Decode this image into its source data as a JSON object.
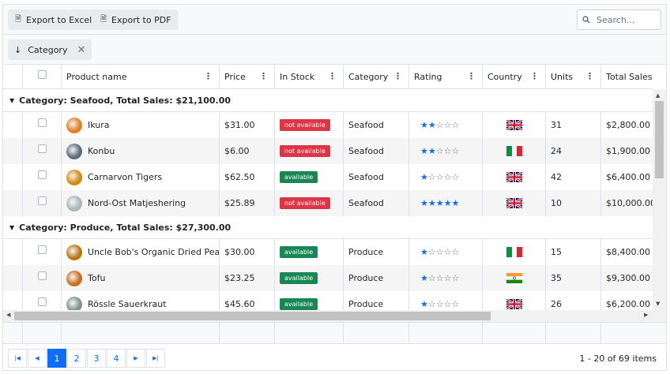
{
  "toolbar": {
    "export_excel_label": "Export to Excel",
    "export_pdf_label": "Export to PDF",
    "search_placeholder": "Search..."
  },
  "group_panel": {
    "chip_label": "Category",
    "chip_sort_glyph": "↓",
    "chip_remove_glyph": "✕"
  },
  "columns": {
    "product": "Product name",
    "price": "Price",
    "in_stock": "In Stock",
    "category": "Category",
    "rating": "Rating",
    "country": "Country",
    "units": "Units",
    "total_sales": "Total Sales"
  },
  "groups": [
    {
      "label": "Category: Seafood, Total Sales: $21,100.00",
      "rows": [
        {
          "name": "Ikura",
          "price": "$31.00",
          "stock": "not available",
          "category": "Seafood",
          "rating": 2,
          "flag": "uk",
          "units": "31",
          "total": "$2,800.00",
          "avatar_color": "#e67e22"
        },
        {
          "name": "Konbu",
          "price": "$6.00",
          "stock": "not available",
          "category": "Seafood",
          "rating": 2,
          "flag": "italy",
          "units": "24",
          "total": "$1,900.00",
          "avatar_color": "#5d6d7e"
        },
        {
          "name": "Carnarvon Tigers",
          "price": "$62.50",
          "stock": "available",
          "category": "Seafood",
          "rating": 1,
          "flag": "uk",
          "units": "42",
          "total": "$6,400.00",
          "avatar_color": "#d68910"
        },
        {
          "name": "Nord-Ost Matjeshering",
          "price": "$25.89",
          "stock": "not available",
          "category": "Seafood",
          "rating": 5,
          "flag": "uk",
          "units": "10",
          "total": "$10,000.00",
          "avatar_color": "#aab7b8"
        }
      ]
    },
    {
      "label": "Category: Produce, Total Sales: $27,300.00",
      "rows": [
        {
          "name": "Uncle Bob's Organic Dried Pears",
          "price": "$30.00",
          "stock": "available",
          "category": "Produce",
          "rating": 1,
          "flag": "italy",
          "units": "15",
          "total": "$8,400.00",
          "avatar_color": "#b9770e"
        },
        {
          "name": "Tofu",
          "price": "$23.25",
          "stock": "available",
          "category": "Produce",
          "rating": 1,
          "flag": "india",
          "units": "35",
          "total": "$9,300.00",
          "avatar_color": "#ca6f1e"
        },
        {
          "name": "Rössle Sauerkraut",
          "price": "$45.60",
          "stock": "available",
          "category": "Produce",
          "rating": 1,
          "flag": "uk",
          "units": "26",
          "total": "$6,200.00",
          "avatar_color": "#839192"
        }
      ]
    }
  ],
  "colors": {
    "available": "#198754",
    "not_available": "#dc3545",
    "accent": "#0d6efd"
  },
  "pager": {
    "pages": [
      "1",
      "2",
      "3",
      "4"
    ],
    "current_page": "1",
    "info": "1 - 20 of 69 items"
  }
}
